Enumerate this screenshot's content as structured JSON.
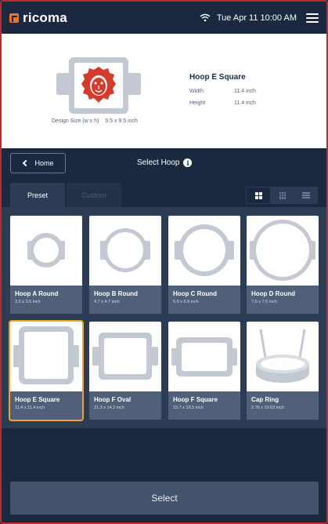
{
  "status_bar": {
    "brand": "ricoma",
    "datetime": "Tue Apr 11  10:00 AM"
  },
  "preview": {
    "design_size_label": "Design Size (w x h)",
    "design_size_value": "9.5 x 9.5 inch",
    "hoop_name": "Hoop E Square",
    "width_label": "Width",
    "width_value": "11.4 inch",
    "height_label": "Height",
    "height_value": "11.4 inch"
  },
  "nav": {
    "home_label": "Home",
    "title": "Select Hoop"
  },
  "tabs": [
    {
      "label": "Preset",
      "active": true
    },
    {
      "label": "Custom",
      "active": false
    }
  ],
  "view_modes": [
    "large-grid",
    "small-grid",
    "list"
  ],
  "hoops": [
    {
      "name": "Hoop A Round",
      "size": "3.5 x 3.5 inch",
      "shape": "round-small"
    },
    {
      "name": "Hoop B Round",
      "size": "4.7 x 4.7 inch",
      "shape": "round-medium"
    },
    {
      "name": "Hoop C Round",
      "size": "5.9 x 5.9 inch",
      "shape": "round-large"
    },
    {
      "name": "Hoop D Round",
      "size": "7.5 x 7.5 inch",
      "shape": "round-xlarge"
    },
    {
      "name": "Hoop E Square",
      "size": "11.4 x 11.4 inch",
      "shape": "square",
      "selected": true
    },
    {
      "name": "Hoop F Oval",
      "size": "21.3 x 14.2 inch",
      "shape": "oval"
    },
    {
      "name": "Hoop F Square",
      "size": "15.7 x 16.5 inch",
      "shape": "rect"
    },
    {
      "name": "Cap Ring",
      "size": "2.76 x 10.63 inch",
      "shape": "cap-ring"
    }
  ],
  "select_label": "Select",
  "colors": {
    "background": "#1b2940",
    "panel": "#2d3c55",
    "card_label": "#516079",
    "hoop_gray": "#c3c8d2",
    "selected_outline": "#f0a22e",
    "logo_orange": "#e8762e",
    "design_red": "#d63a2b"
  }
}
